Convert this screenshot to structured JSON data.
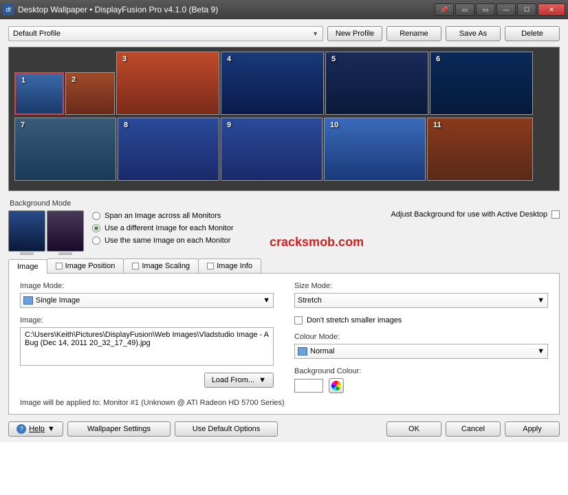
{
  "window": {
    "title": "Desktop Wallpaper • DisplayFusion Pro v4.1.0 (Beta 9)"
  },
  "toolbar": {
    "profile_selected": "Default Profile",
    "new_profile": "New Profile",
    "rename": "Rename",
    "save_as": "Save As",
    "delete": "Delete"
  },
  "monitors": [
    {
      "num": "1",
      "selected": true
    },
    {
      "num": "2"
    },
    {
      "num": "3"
    },
    {
      "num": "4"
    },
    {
      "num": "5"
    },
    {
      "num": "6"
    },
    {
      "num": "7"
    },
    {
      "num": "8"
    },
    {
      "num": "9"
    },
    {
      "num": "10"
    },
    {
      "num": "11"
    }
  ],
  "bgmode": {
    "section_label": "Background Mode",
    "opt_span": "Span an Image across all Monitors",
    "opt_diff": "Use a different Image for each Monitor",
    "opt_same": "Use the same Image on each Monitor",
    "selected_index": 1,
    "adjust_label": "Adjust Background for use with Active Desktop",
    "adjust_checked": false
  },
  "watermark": "cracksmob.com",
  "tabs": {
    "items": [
      "Image",
      "Image Position",
      "Image Scaling",
      "Image Info"
    ],
    "active": 0
  },
  "image_tab": {
    "image_mode_label": "Image Mode:",
    "image_mode_value": "Single Image",
    "image_label": "Image:",
    "image_path": "C:\\Users\\Keith\\Pictures\\DisplayFusion\\Web Images\\Vladstudio Image - A Bug (Dec 14, 2011 20_32_17_49).jpg",
    "load_from": "Load From...",
    "size_mode_label": "Size Mode:",
    "size_mode_value": "Stretch",
    "dont_stretch_label": "Don't stretch smaller images",
    "dont_stretch_checked": false,
    "colour_mode_label": "Colour Mode:",
    "colour_mode_value": "Normal",
    "bg_colour_label": "Background Colour:",
    "bg_colour_value": "#ffffff",
    "status": "Image will be applied to: Monitor #1 (Unknown @ ATI Radeon HD 5700 Series)"
  },
  "footer": {
    "help": "Help",
    "wallpaper_settings": "Wallpaper Settings",
    "use_default": "Use Default Options",
    "ok": "OK",
    "cancel": "Cancel",
    "apply": "Apply"
  }
}
